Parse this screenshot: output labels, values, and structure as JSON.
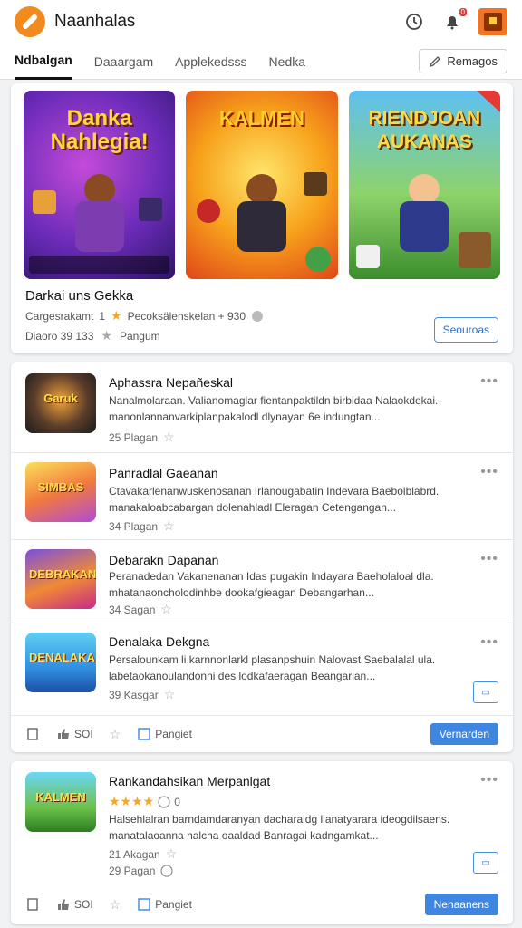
{
  "topbar": {
    "brand": "Naanhalas",
    "icons": [
      "clock-icon",
      "notification-icon",
      "avatar"
    ],
    "notif_count": "0"
  },
  "tabs": {
    "items": [
      "Ndbalgan",
      "Daaargam",
      "Applekedsss",
      "Nedka"
    ],
    "active_index": 0,
    "action_label": "Remagos"
  },
  "featured": {
    "banners": [
      {
        "title": "Danka Nahlegia!"
      },
      {
        "title": "KALMEN"
      },
      {
        "title": "RIENDJOAN AUKANAS"
      }
    ],
    "title": "Darkai uns Gekka",
    "meta_left": "Cargesrakamt",
    "meta_num": "1",
    "meta_right": "Pecoksälenskelan + 930",
    "meta2_left": "Diaoro 39 133",
    "meta2_right": "Pangum",
    "button_label": "Seouroas"
  },
  "list": {
    "rows": [
      {
        "thumb_text": "Garuk",
        "title": "Aphassra Nepañeskal",
        "desc1": "Nanalmolaraan. Valianomaglar fientanpaktildn birbidaa Nalaokdekai.",
        "desc2": "manonlannanvarkiplanpakalodl dlynayan 6e indungtan...",
        "meta": "25 Plagan"
      },
      {
        "thumb_text": "SIMBAS",
        "title": "Panradlal Gaeanan",
        "desc1": "Ctavakarlenanwuskenosanan Irlanougabatin Indevara Baebolblabrd.",
        "desc2": "manakaloabcabargan dolenahladl Eleragan Cetengangan...",
        "meta": "34 Plagan"
      },
      {
        "thumb_text": "DEBRAKAN",
        "title": "Debarakn Dapanan",
        "desc1": "Peranadedan Vakanenanan Idas pugakin Indayara Baeholaloal dla.",
        "desc2": "mhatanaoncholodinhbe dookafgieagan Debangarhan...",
        "meta": "34 Sagan"
      },
      {
        "thumb_text": "DENALAKA",
        "title": "Denalaka Dekgna",
        "desc1": "Persalounkam li karnnonlarkl plasanpshuin Nalovast Saebalalal ula.",
        "desc2": "labetaokanoulandonni des lodkafaeragan Beangarian...",
        "meta": "39 Kasgar"
      }
    ],
    "footer": {
      "share": "SOI",
      "tag": "Pangiet",
      "button": "Vernarden"
    }
  },
  "last": {
    "thumb_text": "KALMEN",
    "title": "Rankandahsikan Merpanlgat",
    "rating_text": "0",
    "desc1": "Halsehlalran barndamdaranyan dacharaldg lianatyarara ideogdilsaens.",
    "desc2": "manatalaoanna nalcha oaaldad Banragai kadngamkat...",
    "meta1": "21 Akagan",
    "meta2": "29 Pagan",
    "footer": {
      "share": "SOI",
      "tag": "Pangiet",
      "button": "Nenaanens"
    }
  },
  "colors": {
    "accent": "#3f86e0",
    "logo": "#f28a1e",
    "star": "#f5a623"
  }
}
